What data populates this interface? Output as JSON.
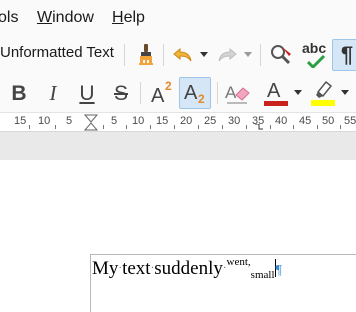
{
  "menu": {
    "tools": "ols",
    "window_acc": "W",
    "window_rest": "indow",
    "help_acc": "H",
    "help_rest": "elp"
  },
  "toolbar": {
    "paragraph_style": "Unformatted Text",
    "spelling_abc": "abc",
    "pilcrow": "¶",
    "bold": "B",
    "italic": "I",
    "underline": "U",
    "strike": "S",
    "superscript_base": "A",
    "superscript_mark": "2",
    "subscript_base": "A",
    "subscript_mark": "2",
    "font_color_letter": "A"
  },
  "colors": {
    "font_color": "#c9211e",
    "highlight": "#ffff00",
    "active_bg": "#d5e7f7",
    "formatting_mark": "#3a8bd1"
  },
  "ruler": {
    "labels": [
      "15",
      "10",
      "5",
      "5",
      "10",
      "15",
      "20",
      "25",
      "30",
      "35",
      "40",
      "45",
      "50",
      "55"
    ]
  },
  "document": {
    "word1": "My",
    "dot": "·",
    "word2": "text",
    "word3": "suddenly",
    "superscript_word": "went,",
    "subscript_word": "small",
    "pilcrow": "¶"
  },
  "icons": {
    "clone_formatting": "paintbrush-icon",
    "undo": "undo-icon",
    "redo": "redo-icon",
    "find_replace": "find-replace-icon",
    "spelling": "spelling-icon",
    "formatting_marks": "pilcrow-icon",
    "clear_formatting": "eraser-icon",
    "highlight": "highlighter-icon",
    "indent_marker": "hourglass-indent-icon"
  }
}
